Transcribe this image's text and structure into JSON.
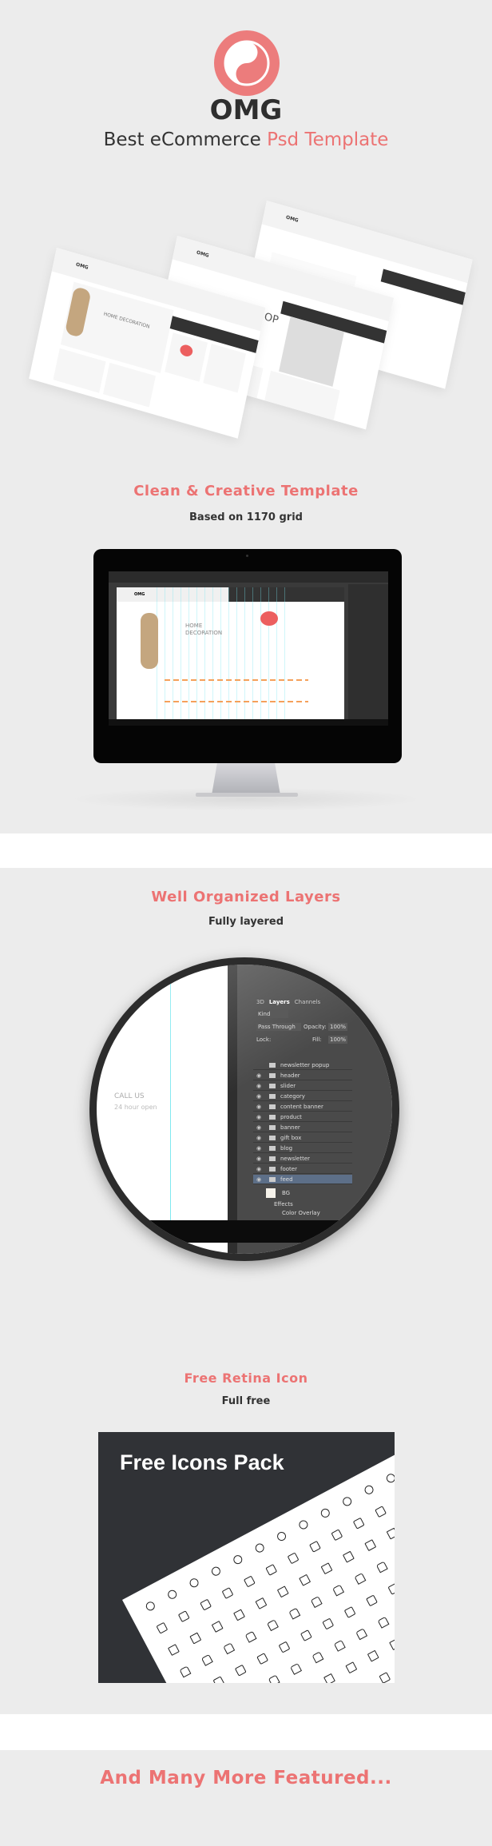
{
  "hero": {
    "brand": "OMG",
    "tagline_dark": "Best eCommerce",
    "tagline_accent": "Psd Template",
    "logo_icon": "yin-yang-icon",
    "accent_color": "#ec7373",
    "mockups": [
      {
        "logo": "OMG",
        "heading": "HOME DECORATION"
      },
      {
        "logo": "OMG",
        "heading": "SHOP"
      },
      {
        "logo": "OMG",
        "heading": ""
      }
    ]
  },
  "sections": [
    {
      "title": "Clean & Creative Template",
      "subtitle": "Based on 1170 grid",
      "screen": {
        "logo": "OMG",
        "heading": "HOME DECORATION"
      }
    },
    {
      "title": "Well Organized Layers",
      "subtitle": "Fully layered",
      "panel": {
        "tabs": [
          "3D",
          "Layers",
          "Channels"
        ],
        "filter": "Kind",
        "blend": "Pass Through",
        "opacity_label": "Opacity:",
        "opacity": "100%",
        "lock_label": "Lock:",
        "fill_label": "Fill:",
        "fill": "100%",
        "layers": [
          "newsletter popup",
          "header",
          "slider",
          "category",
          "content banner",
          "product",
          "banner",
          "gift box",
          "blog",
          "newsletter",
          "footer",
          "feed"
        ],
        "bg_layer": "BG",
        "effects": "Effects",
        "color_overlay": "Color Overlay",
        "selected": "feed"
      },
      "canvas_text": [
        "CALL US",
        "24 hour open"
      ]
    },
    {
      "title": "Free Retina Icon",
      "subtitle": "Full free",
      "pack_title": "Free Icons Pack"
    },
    {
      "title": "And Many More Featured..."
    }
  ]
}
